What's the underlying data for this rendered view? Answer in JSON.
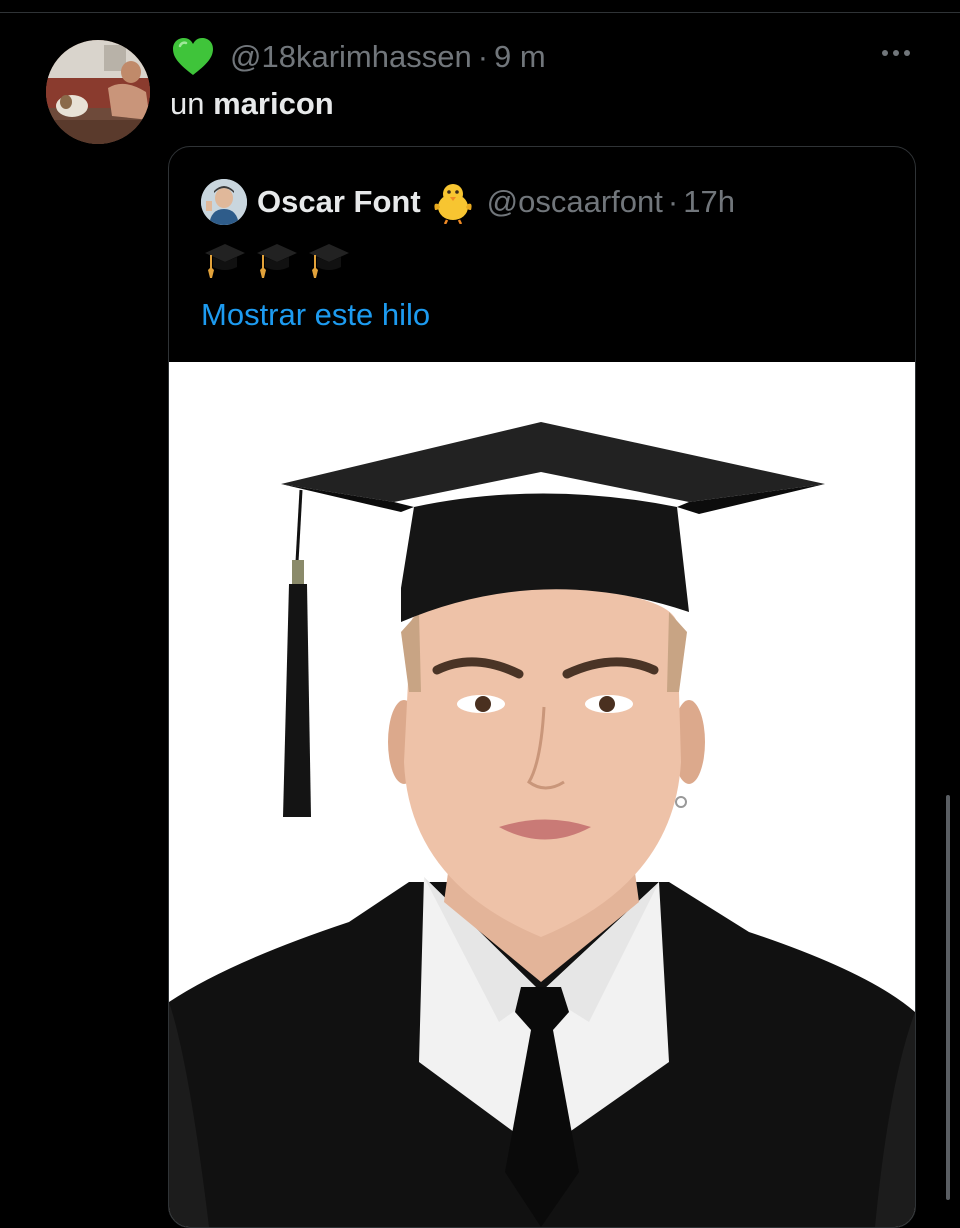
{
  "tweet": {
    "handle": "@18karimhassen",
    "separator": "·",
    "time": "9 m",
    "text_plain": "un ",
    "text_bold": "maricon",
    "heart_icon": "green-heart-icon",
    "more_icon": "more-options-icon"
  },
  "quoted_tweet": {
    "name": "Oscar Font",
    "name_emoji": "baby-chick-icon",
    "handle": "@oscaarfont",
    "separator": "·",
    "time": "17h",
    "text_icons": [
      "graduation-cap-icon",
      "graduation-cap-icon",
      "graduation-cap-icon"
    ],
    "show_thread_label": "Mostrar este hilo",
    "link_color": "#1d9bf0"
  },
  "colors": {
    "background": "#000000",
    "text": "#e7e9ea",
    "secondary_text": "#71767b",
    "heart": "#3fc43a"
  }
}
